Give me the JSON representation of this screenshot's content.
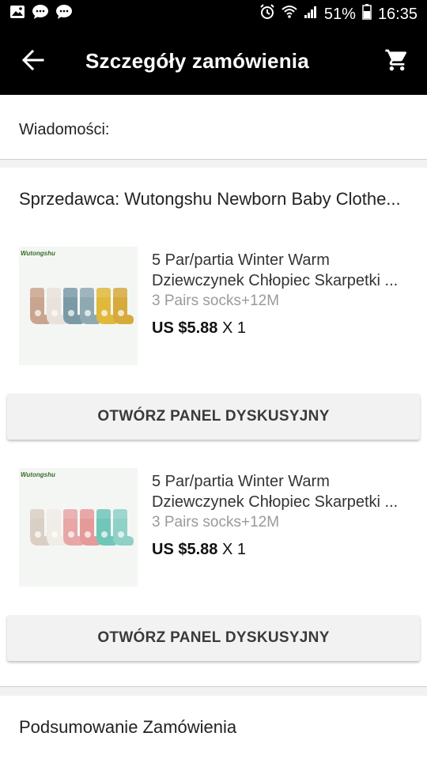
{
  "status_bar": {
    "battery": "51%",
    "time": "16:35",
    "icons": [
      "image-icon",
      "chat-bubble-icon",
      "chat-bubble-icon",
      "alarm-icon",
      "wifi-icon",
      "signal-icon",
      "battery-icon"
    ]
  },
  "app_bar": {
    "title": "Szczegóły zamówienia",
    "back_icon": "arrow-left-icon",
    "cart_icon": "cart-icon"
  },
  "messages": {
    "label": "Wiadomości:"
  },
  "seller": {
    "label": "Sprzedawca: Wutongshu Newborn Baby Clothe..."
  },
  "products": [
    {
      "brand": "Wutongshu",
      "title": "5 Par/partia Winter Warm Dziewczynek Chłopiec Skarpetki ...",
      "variant": "3 Pairs socks+12M",
      "price": "US $5.88",
      "quantity": "X 1",
      "sock_colors": [
        "#c9a48e",
        "#e8e2da",
        "#7a9aa6",
        "#8fa9b0",
        "#e0b93a",
        "#d6aa3c"
      ],
      "button_label": "OTWÓRZ PANEL DYSKUSYJNY"
    },
    {
      "brand": "Wutongshu",
      "title": "5 Par/partia Winter Warm Dziewczynek Chłopiec Skarpetki ...",
      "variant": "3 Pairs socks+12M",
      "price": "US $5.88",
      "quantity": "X 1",
      "sock_colors": [
        "#d9cfc4",
        "#f0ece6",
        "#e8a6a6",
        "#e59a9a",
        "#6fc6b9",
        "#8fd0c7"
      ],
      "button_label": "OTWÓRZ PANEL DYSKUSYJNY"
    }
  ],
  "summary": {
    "label": "Podsumowanie Zamówienia"
  }
}
